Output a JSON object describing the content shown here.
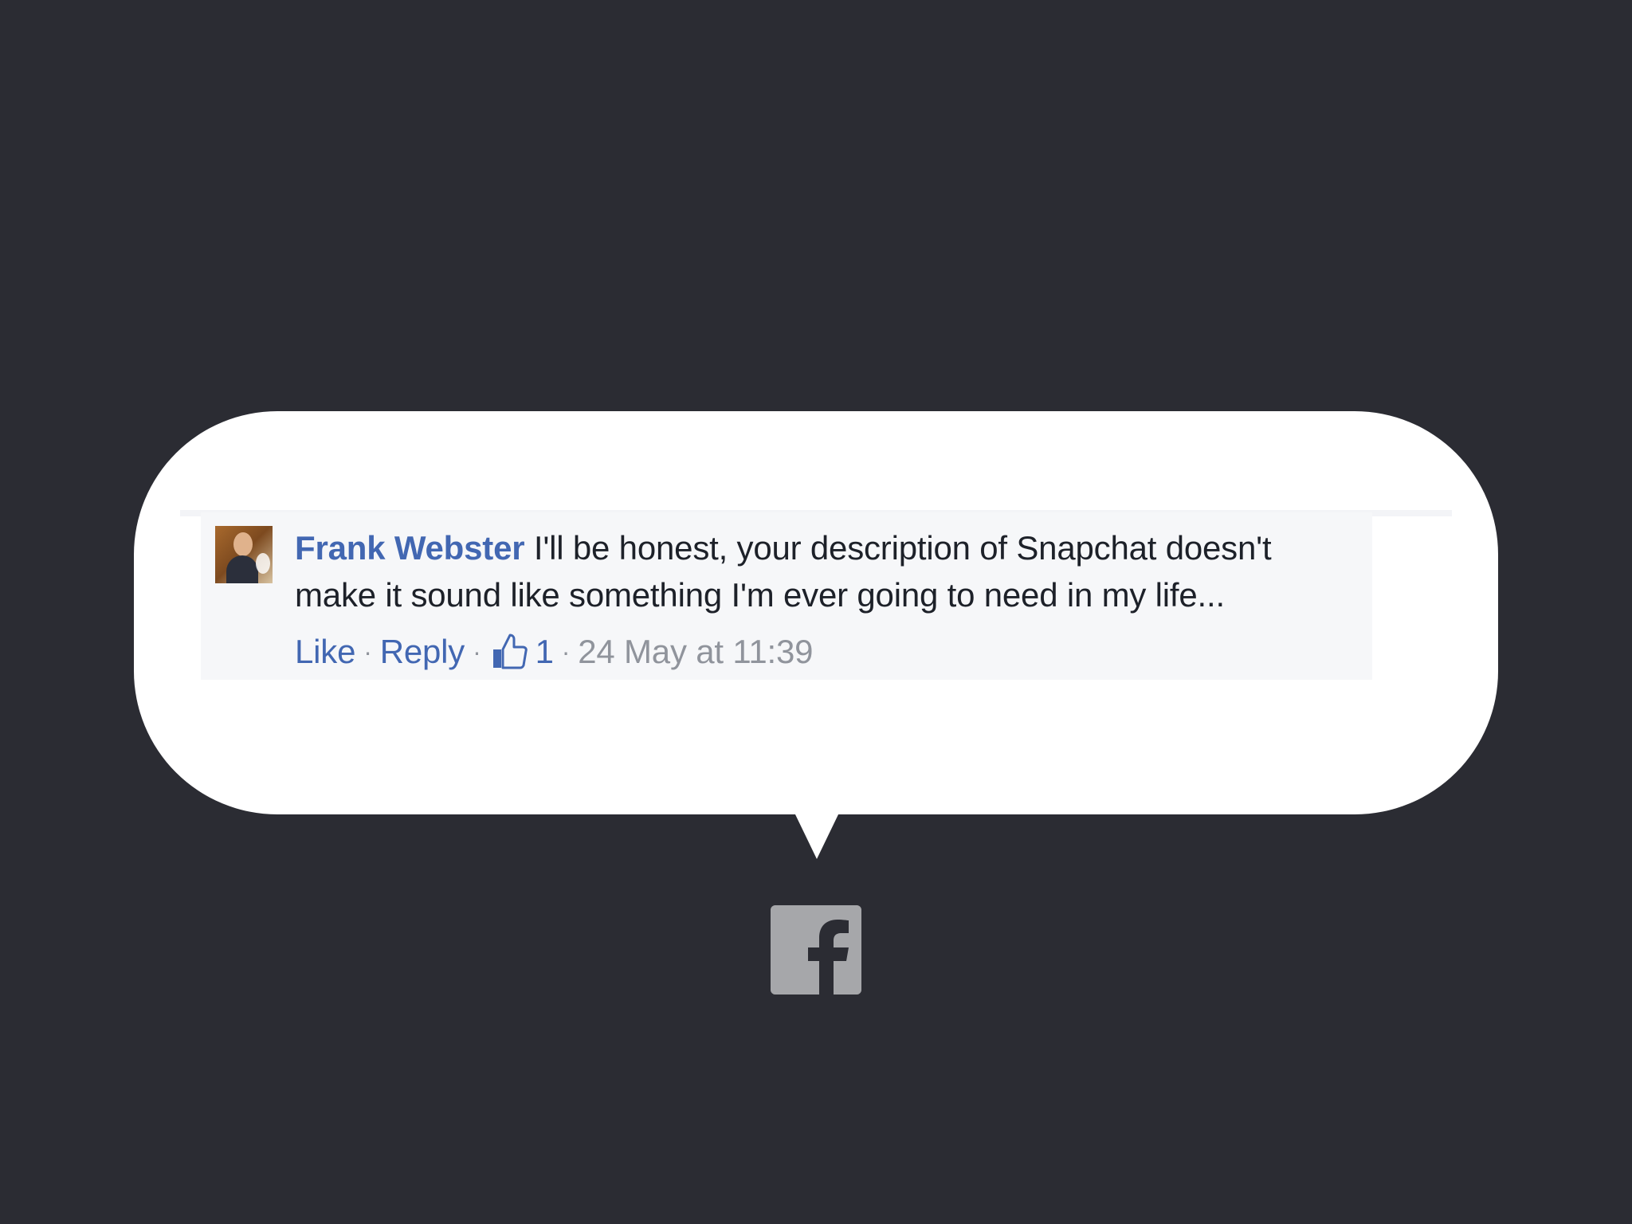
{
  "comment": {
    "author": "Frank Webster",
    "text": "I'll be honest, your description of Snapchat doesn't make it sound like something I'm ever going to need in my life...",
    "actions": {
      "like": "Like",
      "reply": "Reply",
      "separator": "·",
      "like_count": "1",
      "timestamp": "24 May at 11:39"
    }
  },
  "icons": {
    "avatar": "avatar",
    "thumb": "thumbs-up-icon",
    "brand": "facebook-icon"
  },
  "colors": {
    "background": "#2b2c33",
    "bubble": "#ffffff",
    "comment_box": "#f6f7f9",
    "link": "#4267b2",
    "text": "#1d2129",
    "muted": "#90949c",
    "facebook_logo": "#a6a7aa"
  }
}
